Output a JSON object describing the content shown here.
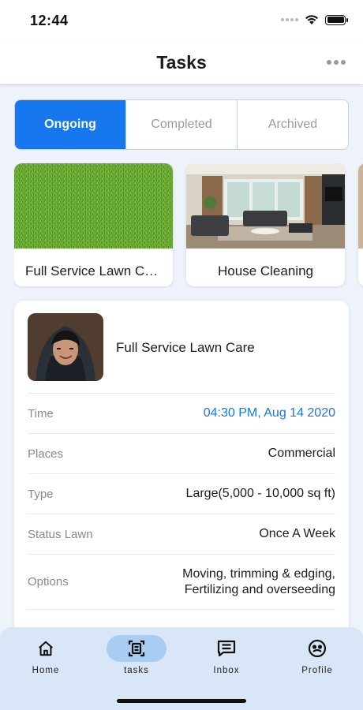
{
  "status_bar": {
    "time": "12:44"
  },
  "header": {
    "title": "Tasks"
  },
  "tabs": [
    {
      "label": "Ongoing",
      "active": true
    },
    {
      "label": "Completed",
      "active": false
    },
    {
      "label": "Archived",
      "active": false
    }
  ],
  "services": [
    {
      "title": "Full Service Lawn Care"
    },
    {
      "title": "House Cleaning"
    }
  ],
  "task": {
    "provider_name": "Full Service Lawn Care",
    "rows": [
      {
        "label": "Time",
        "value": "04:30 PM, Aug 14 2020"
      },
      {
        "label": "Places",
        "value": "Commercial"
      },
      {
        "label": "Type",
        "value": "Large(5,000 - 10,000 sq ft)"
      },
      {
        "label": "Status Lawn",
        "value": "Once A Week"
      },
      {
        "label": "Options",
        "value_line1": "Moving, trimming & edging,",
        "value_line2": "Fertilizing and overseeding"
      }
    ]
  },
  "bottom_nav": [
    {
      "label": "Home",
      "icon": "home-icon",
      "active": false
    },
    {
      "label": "tasks",
      "icon": "tasks-icon",
      "active": true
    },
    {
      "label": "Inbox",
      "icon": "inbox-icon",
      "active": false
    },
    {
      "label": "Profile",
      "icon": "profile-icon",
      "active": false
    }
  ],
  "colors": {
    "accent": "#1677ee",
    "background": "#eef3fb",
    "tab_bar": "#d8e6f8",
    "active_pill": "#a8cdf3"
  }
}
